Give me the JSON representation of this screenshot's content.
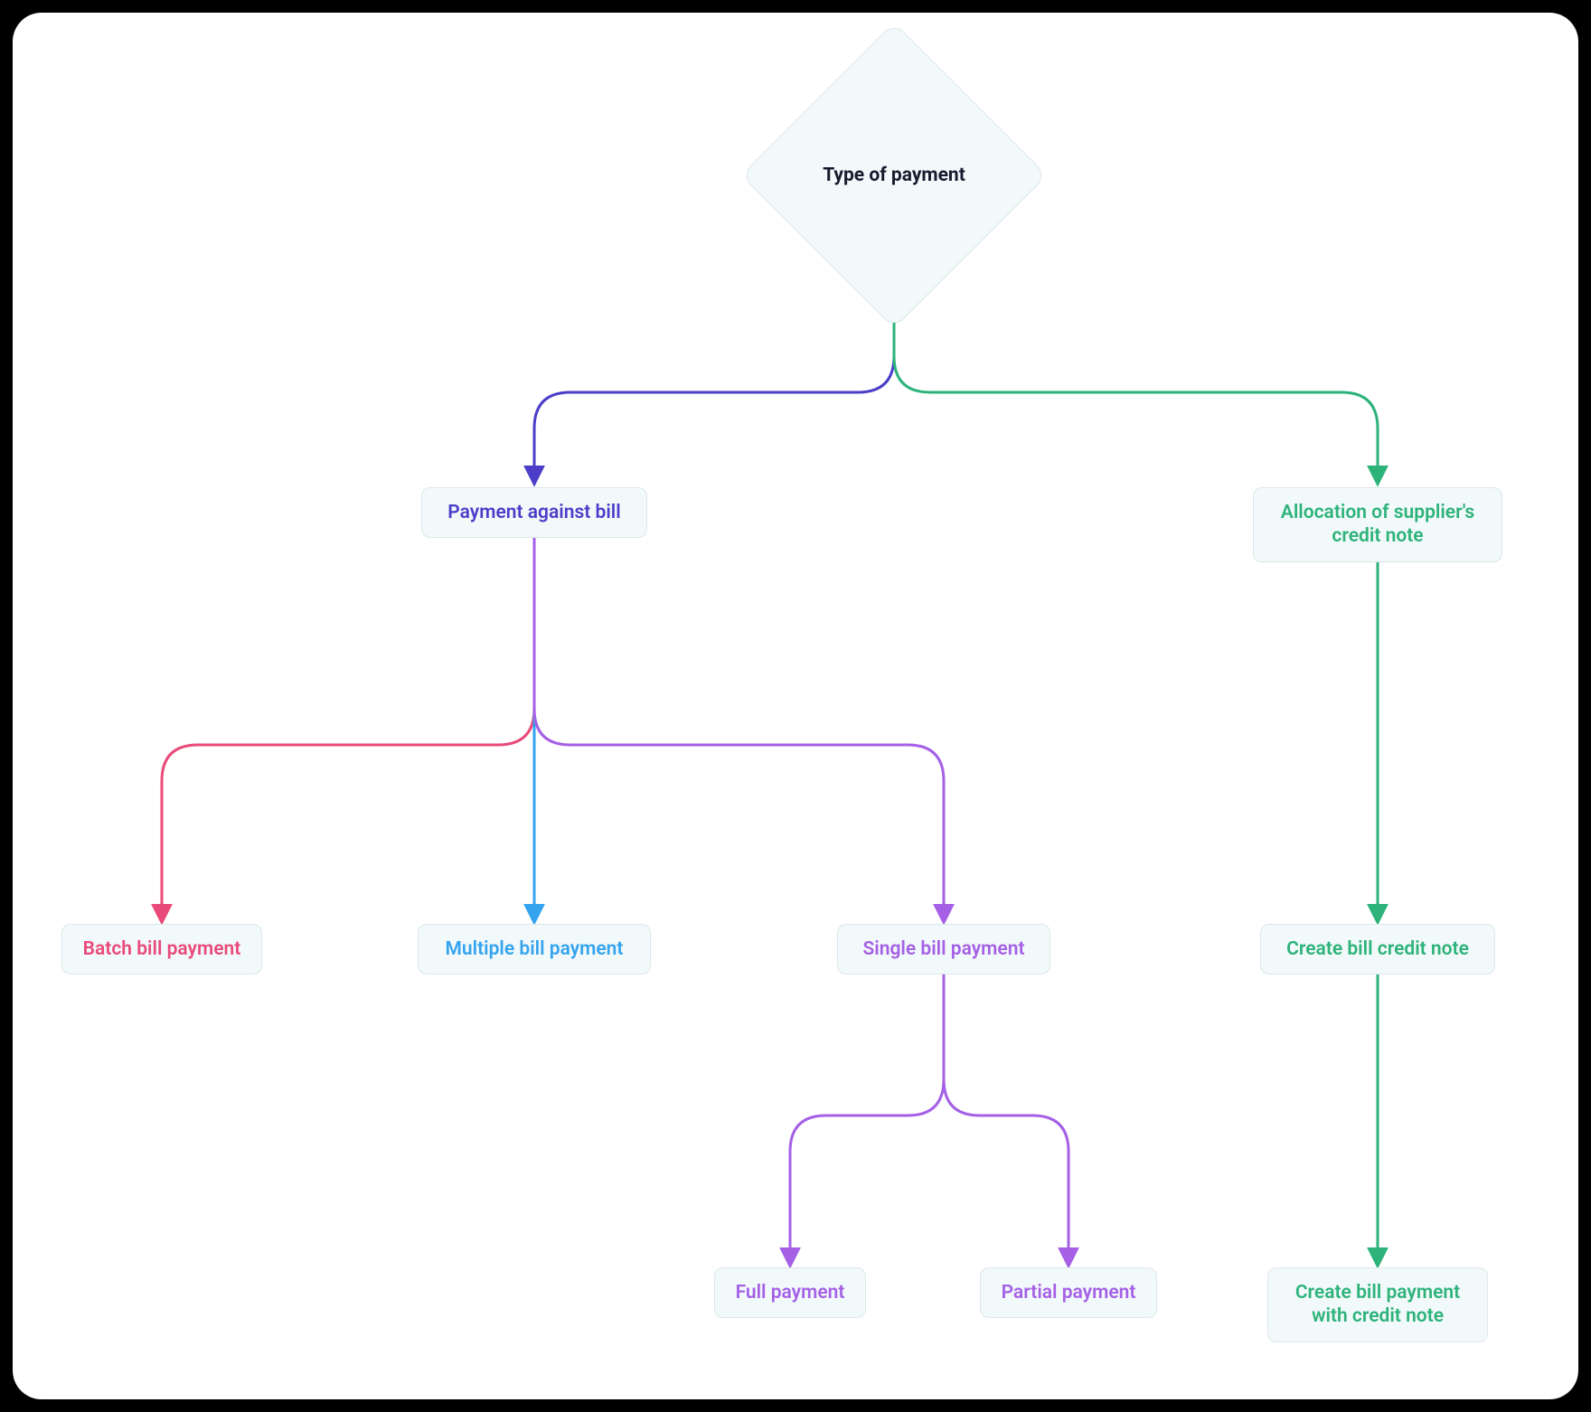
{
  "colors": {
    "indigo": "#4b3ec9",
    "green": "#2db37a",
    "pink": "#e94a7a",
    "blue": "#34a4ef",
    "purple": "#a560e6",
    "textDark": "#1a1a2e"
  },
  "nodes": {
    "root": "Type of payment",
    "paymentAgainstBill": "Payment against bill",
    "allocationCreditNote": "Allocation of supplier's credit note",
    "batchBillPayment": "Batch bill payment",
    "multipleBillPayment": "Multiple bill payment",
    "singleBillPayment": "Single bill payment",
    "createBillCreditNote": "Create bill credit note",
    "fullPayment": "Full payment",
    "partialPayment": "Partial payment",
    "createBillPaymentWithCreditNote": "Create bill payment with credit note"
  }
}
